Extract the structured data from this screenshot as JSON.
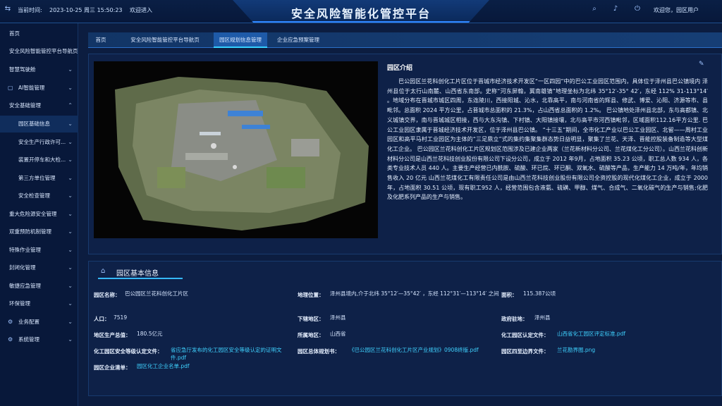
{
  "topbar": {
    "time_label": "当前时间:",
    "datetime": "2023-10-25 周三 15:50:23",
    "welcome_enter": "欢迎进入",
    "app_title": "安全风险智能化管控平台",
    "greeting": "欢迎您，园区用户"
  },
  "sidebar": {
    "items": [
      {
        "label": "首页"
      },
      {
        "label": "安全风险智能管控平台导航页"
      },
      {
        "label": "智慧驾驶舱"
      },
      {
        "label": "AI智能管理"
      },
      {
        "label": "安全基础管理"
      },
      {
        "label": "园区基础信息"
      },
      {
        "label": "安全生产行政许可..."
      },
      {
        "label": "装置开停车和大检..."
      },
      {
        "label": "第三方单位管理"
      },
      {
        "label": "安全检查管理"
      },
      {
        "label": "重大危险源安全管理"
      },
      {
        "label": "双重预防机制管理"
      },
      {
        "label": "特殊作业管理"
      },
      {
        "label": "封闭化管理"
      },
      {
        "label": "敏捷应急管理"
      },
      {
        "label": "环保管理"
      },
      {
        "label": "业务配置"
      },
      {
        "label": "系统管理"
      }
    ]
  },
  "tabs": [
    {
      "label": "首页"
    },
    {
      "label": "安全风险智能管控平台导航页"
    },
    {
      "label": "园区规划信息管理"
    },
    {
      "label": "企业应急预案管理"
    }
  ],
  "intro": {
    "title": "园区介绍",
    "text": "巴公园区兰花科创化工片区位于晋城市经济技术开发区“一区四园”中的巴公工业园区范围内，具体位于泽州县巴公镇境内 泽州县位于太行山南麓、山西省东南部。史称“河东屏翰，冀南雄镇”地理坐标为北纬 35°12′-35° 42′，东经 112% 31-113°14′ 。地域分布在晋城市城区四周，东连陵川，西接阳城、沁水，北靠高平，南与河南省的辉县、修武、博爱、沁阳、济源等市、县毗邻。总面积 2024 平方公里，占晋城市总面积的 21.3%，占山西省总面积的 1.2%。 巴公镇地处泽州县北部，东与高都镇、北义城镇交界，南与晋城城区相接，西与大东沟镇、下村镇、大阳镇接壤，北与高平市河西镇毗邻，区域面积112.16平方公里. 巴公工业园区隶属于晋城经济技术开发区，位于泽州县巴公镇。 “十三五”期间，全市化工产业以巴公工业园区、北留——周村工业园区和高平马村工业园区为主体的“三足鼎立”式的集约集聚集群态势日益明显，聚集了兰花、天泽、晋能控股装备制造等大型煤化工企业。 巴公园区兰花科创化工片区规划区范围涉及已建企业两家（兰花新材料分公司、兰花煤化工分公司）。山西兰花科创新材料分公司是山西兰花科技创业股份有限公司下设分公司，成立于 2012 年9月，占地面积 35.23 公顷，职工总人数 934 人，各类专业技术人员 440 人。主要生产经营已内酰胺、硫酸、环已烷、环已酮、双氧水、硫酸等产品，生产能力 14 万吨/年，年均销售收入 20 亿元 山西兰花煤化工有限责任公司是由山西兰花科技创业股份有限公司全资控股的现代化煤化工企业，成立于 2000 年，占地面积 30.51 公顷，现有职工952 人，经营范围包含液氨、硫磺、甲醇、煤气、合成气、二氧化碳气的生产与销售;化肥及化肥系列产品的生产与销售。"
  },
  "info": {
    "title": "园区基本信息",
    "fields": [
      {
        "label": "园区名称：",
        "value": "巴公园区兰花科创化工片区"
      },
      {
        "label": "地理位置：",
        "value": "泽州县境内,介于北纬 35°12′—35°42′ ，东经 112°31′—113°14′ 之间"
      },
      {
        "label": "面积：",
        "value": "115.387公顷"
      },
      {
        "label": "人口：",
        "value": "7519"
      },
      {
        "label": "下辖地区：",
        "value": "泽州县"
      },
      {
        "label": "政府驻地：",
        "value": "泽州县"
      },
      {
        "label": "地区生产总值：",
        "value": "180.5亿元"
      },
      {
        "label": "所属地区：",
        "value": "山西省"
      },
      {
        "label": "化工园区认定文件：",
        "value": "山西省化工园区评定标准.pdf"
      },
      {
        "label": "化工园区安全等级认定文件：",
        "value": "省应急厅发布的化工园区安全等级认定的证明文件.pdf"
      },
      {
        "label": "园区总体规划书：",
        "value": "《巴公园区兰花科创化工片区产业规划》0908终版.pdf"
      },
      {
        "label": "园区四至边界文件：",
        "value": "兰花勘界图.png"
      },
      {
        "label": "园区企业清单：",
        "value": "园区化工企业名单.pdf"
      }
    ]
  },
  "colors": {
    "accent": "#36b8ff",
    "link": "#3fd2ff",
    "bg": "#0b1b3a"
  }
}
